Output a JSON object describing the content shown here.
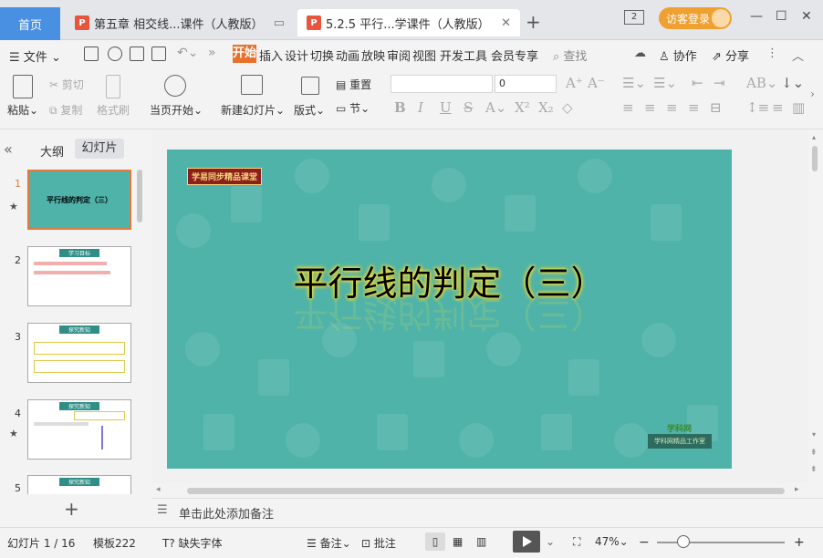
{
  "tabs": {
    "home": "首页",
    "doc1": "第五章 相交线...课件（人教版）",
    "doc2": "5.2.5 平行...学课件（人教版）",
    "new_tab": "+",
    "window_count": "2",
    "login": "访客登录"
  },
  "menu": {
    "file": "文件",
    "tabs": [
      "开始",
      "插入",
      "设计",
      "切换",
      "动画",
      "放映",
      "审阅",
      "视图",
      "开发工具",
      "会员专享"
    ],
    "search": "查找",
    "collab": "协作",
    "share": "分享"
  },
  "ribbon": {
    "paste": "粘贴",
    "cut": "剪切",
    "copy": "复制",
    "format_painter": "格式刷",
    "from_current": "当页开始",
    "new_slide": "新建幻灯片",
    "layout": "版式",
    "reset": "重置",
    "section": "节",
    "font_size": "0"
  },
  "left_pane": {
    "outline_tab": "大纲",
    "slides_tab": "幻灯片",
    "slide_numbers": [
      "1",
      "2",
      "3",
      "4",
      "5"
    ],
    "thumb1_title": "平行线的判定（三）",
    "thumb2_title": "学习目标",
    "thumb3_title": "探究新知",
    "thumb4_title": "探究新知",
    "thumb5_title": "探究新知"
  },
  "slide": {
    "brand_tag": "学易同步精品课堂",
    "title": "平行线的判定（三）",
    "logo_top": "学科网",
    "logo_bottom": "学科网精品工作室"
  },
  "notes_placeholder": "单击此处添加备注",
  "status": {
    "slide_info": "幻灯片 1 / 16",
    "template": "模板222",
    "missing_font": "缺失字体",
    "notes": "备注",
    "comments": "批注",
    "zoom": "47%"
  }
}
